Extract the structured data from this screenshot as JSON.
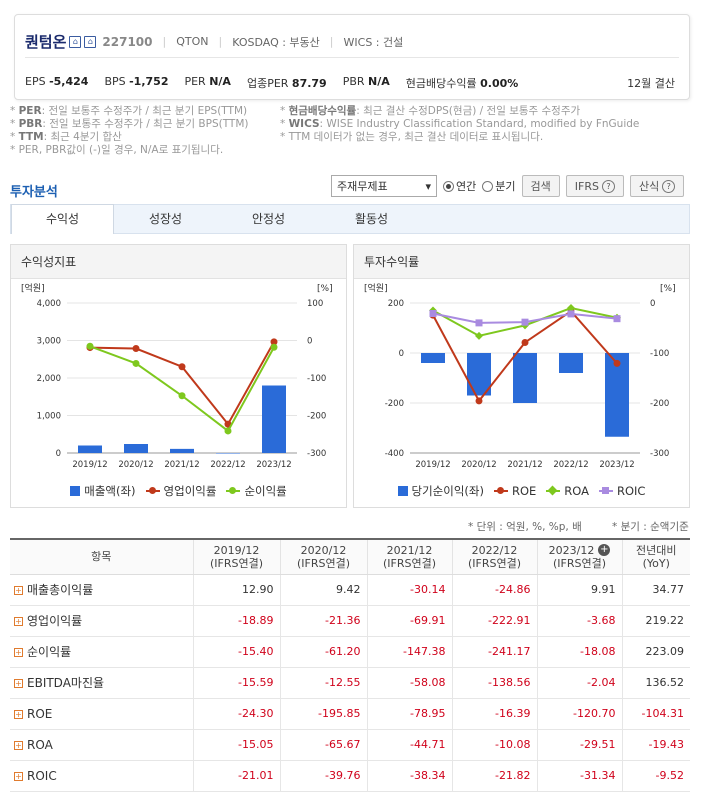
{
  "header": {
    "name": "퀀텀온",
    "code": "227100",
    "ticker": "QTON",
    "market": "KOSDAQ : 부동산",
    "wics": "WICS : 건설",
    "stats": [
      {
        "label": "EPS",
        "value": "-5,424"
      },
      {
        "label": "BPS",
        "value": "-1,752"
      },
      {
        "label": "PER",
        "value": "N/A"
      },
      {
        "label": "업종PER",
        "value": "87.79"
      },
      {
        "label": "PBR",
        "value": "N/A"
      },
      {
        "label": "현금배당수익률",
        "value": "0.00%"
      }
    ],
    "settlement": "12월 결산"
  },
  "notes": {
    "left": [
      {
        "key": "PER",
        "text": ": 전일 보통주 수정주가 / 최근 분기 EPS(TTM)"
      },
      {
        "key": "PBR",
        "text": ": 전일 보통주 수정주가 / 최근 분기 BPS(TTM)"
      },
      {
        "key": "TTM",
        "text": ": 최근 4분기 합산"
      },
      {
        "key": "",
        "text": "PER, PBR값이 (-)일 경우, N/A로 표기됩니다."
      }
    ],
    "right": [
      {
        "key": "현금배당수익률",
        "text": ": 최근 결산 수정DPS(현금) / 전일 보통주 수정주가"
      },
      {
        "key": "WICS",
        "text": ": WISE Industry Classification Standard, modified by FnGuide"
      },
      {
        "key": "",
        "text": "TTM 데이터가 없는 경우, 최근 결산 데이터로 표시됩니다."
      }
    ]
  },
  "analysis": {
    "title": "투자분석",
    "select_value": "주재무제표",
    "radio_annual": "연간",
    "radio_quarter": "분기",
    "search_label": "검색",
    "ifrs_label": "IFRS",
    "formula_label": "산식",
    "tabs": [
      "수익성",
      "성장성",
      "안정성",
      "활동성"
    ]
  },
  "chart_left_title": "수익성지표",
  "chart_right_title": "투자수익률",
  "chart_data": [
    {
      "type": "bar",
      "title": "수익성지표",
      "categories": [
        "2019/12",
        "2020/12",
        "2021/12",
        "2022/12",
        "2023/12"
      ],
      "ylabel_left": "[억원]",
      "ylabel_right": "[%]",
      "yticks_left": [
        "4,000",
        "3,000",
        "2,000",
        "1,000",
        "0"
      ],
      "yticks_right": [
        "100",
        "0",
        "-100",
        "-200",
        "-300"
      ],
      "ylim_left": [
        0,
        4000
      ],
      "ylim_right": [
        -300,
        100
      ],
      "series": [
        {
          "name": "매출액(좌)",
          "axis": "left",
          "kind": "bar",
          "color": "#2a6bd8",
          "values": [
            200,
            240,
            110,
            0,
            1800
          ]
        },
        {
          "name": "영업이익률",
          "axis": "right",
          "kind": "line",
          "color": "#c0391b",
          "values": [
            -18.89,
            -21.36,
            -69.91,
            -222.91,
            -3.68
          ]
        },
        {
          "name": "순이익률",
          "axis": "right",
          "kind": "line",
          "color": "#7ec81e",
          "values": [
            -15.4,
            -61.2,
            -147.38,
            -241.17,
            -18.08
          ]
        }
      ]
    },
    {
      "type": "bar",
      "title": "투자수익률",
      "categories": [
        "2019/12",
        "2020/12",
        "2021/12",
        "2022/12",
        "2023/12"
      ],
      "ylabel_left": "[억원]",
      "ylabel_right": "[%]",
      "yticks_left": [
        "200",
        "0",
        "-200",
        "-400"
      ],
      "yticks_right": [
        "0",
        "-100",
        "-200",
        "-300"
      ],
      "ylim_left": [
        -400,
        200
      ],
      "ylim_right": [
        -300,
        0
      ],
      "series": [
        {
          "name": "당기순이익(좌)",
          "axis": "left",
          "kind": "bar",
          "color": "#2a6bd8",
          "values": [
            -40,
            -170,
            -200,
            -80,
            -335
          ]
        },
        {
          "name": "ROE",
          "axis": "right",
          "kind": "line",
          "color": "#c0391b",
          "values": [
            -24.3,
            -195.85,
            -78.95,
            -16.39,
            -120.7
          ]
        },
        {
          "name": "ROA",
          "axis": "right",
          "kind": "line",
          "color": "#7ec81e",
          "values": [
            -15.05,
            -65.67,
            -44.71,
            -10.08,
            -29.51
          ]
        },
        {
          "name": "ROIC",
          "axis": "right",
          "kind": "line",
          "color": "#a98be0",
          "values": [
            -21.01,
            -39.76,
            -38.34,
            -21.82,
            -31.34
          ]
        }
      ]
    }
  ],
  "footnote_unit": "* 단위 : 억원, %, %p, 배",
  "footnote_quarter": "* 분기 : 순액기준",
  "table": {
    "col_item": "항목",
    "columns": [
      {
        "l1": "2019/12",
        "l2": "(IFRS연결)"
      },
      {
        "l1": "2020/12",
        "l2": "(IFRS연결)"
      },
      {
        "l1": "2021/12",
        "l2": "(IFRS연결)"
      },
      {
        "l1": "2022/12",
        "l2": "(IFRS연결)"
      },
      {
        "l1": "2023/12",
        "l2": "(IFRS연결)"
      }
    ],
    "col_yoy_l1": "전년대비",
    "col_yoy_l2": "(YoY)",
    "rows": [
      {
        "label": "매출총이익률",
        "values": [
          "12.90",
          "9.42",
          "-30.14",
          "-24.86",
          "9.91",
          "34.77"
        ]
      },
      {
        "label": "영업이익률",
        "values": [
          "-18.89",
          "-21.36",
          "-69.91",
          "-222.91",
          "-3.68",
          "219.22"
        ]
      },
      {
        "label": "순이익률",
        "values": [
          "-15.40",
          "-61.20",
          "-147.38",
          "-241.17",
          "-18.08",
          "223.09"
        ]
      },
      {
        "label": "EBITDA마진율",
        "values": [
          "-15.59",
          "-12.55",
          "-58.08",
          "-138.56",
          "-2.04",
          "136.52"
        ]
      },
      {
        "label": "ROE",
        "values": [
          "-24.30",
          "-195.85",
          "-78.95",
          "-16.39",
          "-120.70",
          "-104.31"
        ]
      },
      {
        "label": "ROA",
        "values": [
          "-15.05",
          "-65.67",
          "-44.71",
          "-10.08",
          "-29.51",
          "-19.43"
        ]
      },
      {
        "label": "ROIC",
        "values": [
          "-21.01",
          "-39.76",
          "-38.34",
          "-21.82",
          "-31.34",
          "-9.52"
        ]
      }
    ]
  }
}
